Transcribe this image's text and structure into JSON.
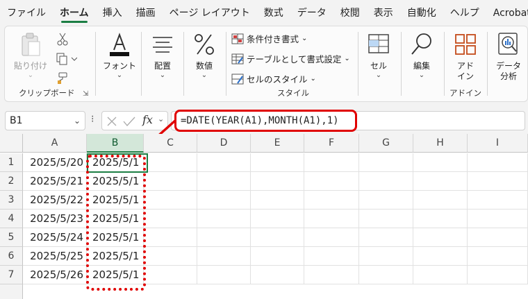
{
  "menu": {
    "tabs": [
      "ファイル",
      "ホーム",
      "挿入",
      "描画",
      "ページ レイアウト",
      "数式",
      "データ",
      "校閲",
      "表示",
      "自動化",
      "ヘルプ",
      "Acrobat"
    ],
    "active": "ホーム"
  },
  "ribbon": {
    "clipboard": {
      "paste": "貼り付け",
      "group_label": "クリップボード"
    },
    "font": {
      "label": "フォント"
    },
    "alignment": {
      "label": "配置"
    },
    "number": {
      "label": "数値"
    },
    "styles": {
      "conditional": "条件付き書式",
      "table": "テーブルとして書式設定",
      "cell_style": "セルのスタイル",
      "group_label": "スタイル"
    },
    "cells": {
      "label": "セル"
    },
    "editing": {
      "label": "編集"
    },
    "addins": {
      "label_line1": "アド",
      "label_line2": "イン",
      "group_label": "アドイン"
    },
    "analysis": {
      "label_line1": "データ",
      "label_line2": "分析"
    }
  },
  "formula_bar": {
    "name_box": "B1",
    "formula": "=DATE(YEAR(A1),MONTH(A1),1)"
  },
  "sheet": {
    "columns": [
      "A",
      "B",
      "C",
      "D",
      "E",
      "F",
      "G",
      "H",
      "I"
    ],
    "selected_column": "B",
    "rows": [
      {
        "n": "1",
        "a": "2025/5/20",
        "b": "2025/5/1"
      },
      {
        "n": "2",
        "a": "2025/5/21",
        "b": "2025/5/1"
      },
      {
        "n": "3",
        "a": "2025/5/22",
        "b": "2025/5/1"
      },
      {
        "n": "4",
        "a": "2025/5/23",
        "b": "2025/5/1"
      },
      {
        "n": "5",
        "a": "2025/5/24",
        "b": "2025/5/1"
      },
      {
        "n": "6",
        "a": "2025/5/25",
        "b": "2025/5/1"
      },
      {
        "n": "7",
        "a": "2025/5/26",
        "b": "2025/5/1"
      }
    ]
  },
  "colors": {
    "accent": "#1b7e43",
    "highlight": "#e00000"
  }
}
